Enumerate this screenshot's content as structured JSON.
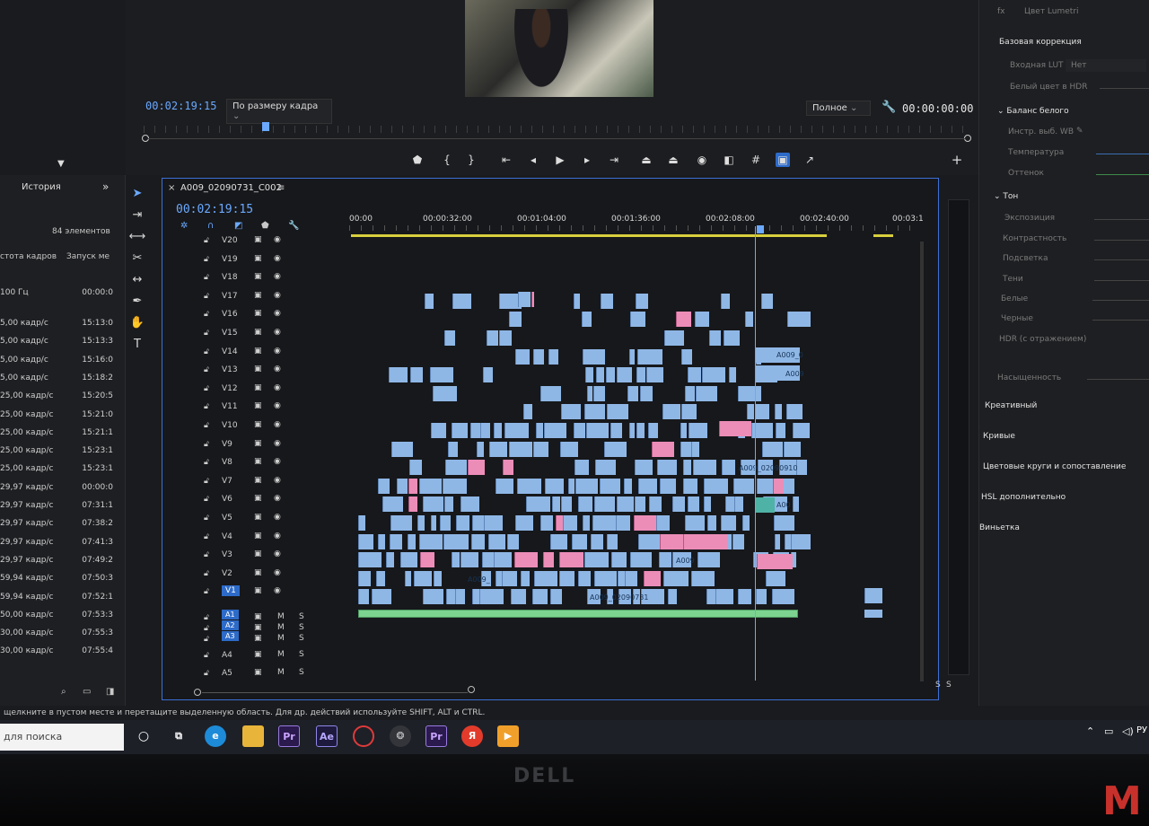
{
  "program": {
    "timecode_left": "00:02:19:15",
    "fit_dropdown": "По размеру кадра",
    "quality_dropdown": "Полное",
    "timecode_right": "00:00:00:00"
  },
  "left_panel": {
    "tab": "История",
    "count": "84 элементов",
    "col_fps": "стота кадров",
    "col_start": "Запуск ме",
    "rows": [
      {
        "fps": "100 Гц",
        "start": "00:00:0"
      },
      {
        "fps": "5,00 кадр/с",
        "start": "15:13:0"
      },
      {
        "fps": "5,00 кадр/с",
        "start": "15:13:3"
      },
      {
        "fps": "5,00 кадр/с",
        "start": "15:16:0"
      },
      {
        "fps": "5,00 кадр/с",
        "start": "15:18:2"
      },
      {
        "fps": "25,00 кадр/с",
        "start": "15:20:5"
      },
      {
        "fps": "25,00 кадр/с",
        "start": "15:21:0"
      },
      {
        "fps": "25,00 кадр/с",
        "start": "15:21:1"
      },
      {
        "fps": "25,00 кадр/с",
        "start": "15:23:1"
      },
      {
        "fps": "25,00 кадр/с",
        "start": "15:23:1"
      },
      {
        "fps": "29,97 кадр/с",
        "start": "00:00:0"
      },
      {
        "fps": "29,97 кадр/с",
        "start": "07:31:1"
      },
      {
        "fps": "29,97 кадр/с",
        "start": "07:38:2"
      },
      {
        "fps": "29,97 кадр/с",
        "start": "07:41:3"
      },
      {
        "fps": "29,97 кадр/с",
        "start": "07:49:2"
      },
      {
        "fps": "59,94 кадр/с",
        "start": "07:50:3"
      },
      {
        "fps": "59,94 кадр/с",
        "start": "07:52:1"
      },
      {
        "fps": "50,00 кадр/с",
        "start": "07:53:3"
      },
      {
        "fps": "30,00 кадр/с",
        "start": "07:55:3"
      },
      {
        "fps": "30,00 кадр/с",
        "start": "07:55:4"
      }
    ]
  },
  "timeline": {
    "sequence_name": "A009_02090731_C002",
    "timecode": "00:02:19:15",
    "ruler": [
      "00:00",
      "00:00:32:00",
      "00:01:04:00",
      "00:01:36:00",
      "00:02:08:00",
      "00:02:40:00",
      "00:03:1"
    ],
    "video_tracks": [
      "V20",
      "V19",
      "V18",
      "V17",
      "V16",
      "V15",
      "V14",
      "V13",
      "V12",
      "V11",
      "V10",
      "V9",
      "V8",
      "V7",
      "V6",
      "V5",
      "V4",
      "V3",
      "V2",
      "V1"
    ],
    "audio_tracks": [
      "A1",
      "A2",
      "A3",
      "A4",
      "A5"
    ],
    "clip_labels": [
      "A009_0",
      "A009",
      "A009_02090910",
      "A00",
      "A009",
      "A009_",
      "A009_02090731"
    ],
    "m_label": "M",
    "s_label": "S"
  },
  "right_panel": {
    "lumetri": "Цвет Lumetri",
    "basic": "Базовая коррекция",
    "input_lut": "Входная LUT",
    "lut_value": "Нет",
    "hdr_white": "Белый цвет в HDR",
    "wb": "Баланс белого",
    "wb_picker": "Инстр. выб. WB",
    "temp": "Температура",
    "tint": "Оттенок",
    "tone": "Тон",
    "exposure": "Экспозиция",
    "contrast": "Контрастность",
    "highlights": "Подсветка",
    "shadows": "Тени",
    "whites": "Белые",
    "blacks": "Черные",
    "hdr_spec": "HDR (с отражением)",
    "saturation": "Насыщенность",
    "creative": "Креативный",
    "curves": "Кривые",
    "wheels": "Цветовые круги и сопоставление",
    "hsl": "HSL дополнительно",
    "vignette": "Виньетка"
  },
  "status_text": "щелкните в пустом месте и перетащите выделенную область. Для др. действий используйте SHIFT, ALT и CTRL.",
  "taskbar": {
    "search": "для поиска",
    "lang": "РУ",
    "apps": [
      "Pr",
      "Ae",
      "Pr",
      "Я"
    ]
  },
  "monitor_brand": "DELL",
  "watermark": "M",
  "colors": {
    "accent": "#6aa9ff",
    "clip_blue": "#8fb7e6",
    "clip_pink": "#ec8db8",
    "audio_green": "#7bd38f",
    "selection": "#3d6fd6"
  }
}
